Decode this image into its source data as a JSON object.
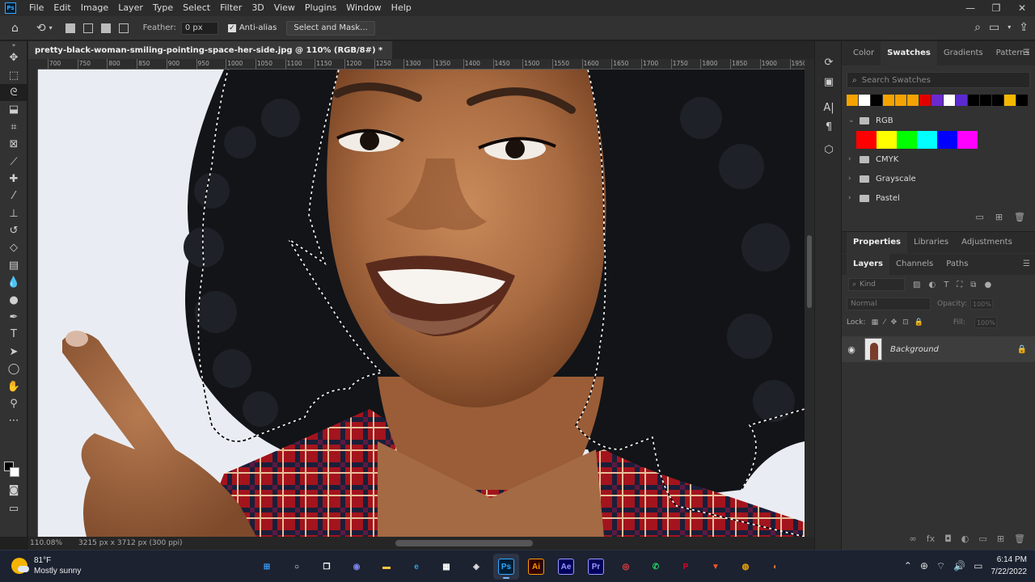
{
  "app": {
    "logo_text": "Ps",
    "menu": [
      "File",
      "Edit",
      "Image",
      "Layer",
      "Type",
      "Select",
      "Filter",
      "3D",
      "View",
      "Plugins",
      "Window",
      "Help"
    ],
    "window_controls": [
      "—",
      "❐",
      "✕"
    ]
  },
  "options_bar": {
    "feather_label": "Feather:",
    "feather_value": "0 px",
    "antialias_label": "Anti-alias",
    "antialias_checked": true,
    "select_mask_label": "Select and Mask..."
  },
  "document": {
    "tab_title": "pretty-black-woman-smiling-pointing-space-her-side.jpg @ 110% (RGB/8#) *",
    "ruler_ticks": [
      "700",
      "750",
      "800",
      "850",
      "900",
      "950",
      "1000",
      "1050",
      "1100",
      "1150",
      "1200",
      "1250",
      "1300",
      "1350",
      "1400",
      "1450",
      "1500",
      "1550",
      "1600",
      "1650",
      "1700",
      "1750",
      "1800",
      "1850",
      "1900",
      "1950"
    ]
  },
  "status": {
    "zoom": "110.08%",
    "doc_info": "3215 px x 3712 px (300 ppi)"
  },
  "swatches_panel": {
    "tabs": [
      "Color",
      "Swatches",
      "Gradients",
      "Patterns"
    ],
    "active_tab": "Swatches",
    "search_placeholder": "Search Swatches",
    "recent": [
      "#f5a300",
      "#ffffff",
      "#000000",
      "#f5a300",
      "#f5a300",
      "#f5a300",
      "#e00000",
      "#6a2ad0",
      "#ffffff",
      "#5a2ad0",
      "#000000",
      "#000000",
      "#000000",
      "#f5b800",
      "#000000"
    ],
    "groups": [
      {
        "name": "RGB",
        "expanded": true
      },
      {
        "name": "CMYK",
        "expanded": false
      },
      {
        "name": "Grayscale",
        "expanded": false
      },
      {
        "name": "Pastel",
        "expanded": false
      }
    ],
    "rgb_colors": [
      "#ff0000",
      "#ffff00",
      "#00ff00",
      "#00ffff",
      "#0000ff",
      "#ff00ff"
    ]
  },
  "properties_panel": {
    "tabs": [
      "Properties",
      "Libraries",
      "Adjustments"
    ],
    "active_tab": "Properties"
  },
  "layers_panel": {
    "tabs": [
      "Layers",
      "Channels",
      "Paths"
    ],
    "active_tab": "Layers",
    "kind_label": "Kind",
    "blend_mode": "Normal",
    "opacity_label": "Opacity:",
    "opacity_value": "100%",
    "lock_label": "Lock:",
    "fill_label": "Fill:",
    "fill_value": "100%",
    "layers": [
      {
        "name": "Background",
        "visible": true,
        "locked": true
      }
    ]
  },
  "taskbar": {
    "weather_temp": "81°F",
    "weather_desc": "Mostly sunny",
    "apps": [
      {
        "name": "Start",
        "label": "⊞",
        "color": "#3aa0ff"
      },
      {
        "name": "Search",
        "label": "○",
        "color": "#ffffff"
      },
      {
        "name": "Task View",
        "label": "❐",
        "color": "#ffffff"
      },
      {
        "name": "Chat",
        "label": "◉",
        "color": "#7b83eb"
      },
      {
        "name": "File Explorer",
        "label": "▬",
        "color": "#ffc83d"
      },
      {
        "name": "Edge",
        "label": "e",
        "color": "#2fa4e7"
      },
      {
        "name": "Store",
        "label": "▦",
        "color": "#ffffff"
      },
      {
        "name": "DaVinci",
        "label": "◈",
        "color": "#dddddd"
      },
      {
        "name": "Photoshop",
        "label": "Ps",
        "color": "#31a8ff"
      },
      {
        "name": "Illustrator",
        "label": "Ai",
        "color": "#ff9a00"
      },
      {
        "name": "After Effects",
        "label": "Ae",
        "color": "#9999ff"
      },
      {
        "name": "Premiere",
        "label": "Pr",
        "color": "#9999ff"
      },
      {
        "name": "Screen Recorder",
        "label": "◎",
        "color": "#ff4040"
      },
      {
        "name": "WhatsApp",
        "label": "✆",
        "color": "#25d366"
      },
      {
        "name": "Pinterest",
        "label": "P",
        "color": "#e60023"
      },
      {
        "name": "Brave",
        "label": "▼",
        "color": "#fb542b"
      },
      {
        "name": "Chrome Canary",
        "label": "◍",
        "color": "#f2a900"
      },
      {
        "name": "Firefox",
        "label": "◐",
        "color": "#ff7139"
      }
    ],
    "time": "6:14 PM",
    "date": "7/22/2022"
  }
}
